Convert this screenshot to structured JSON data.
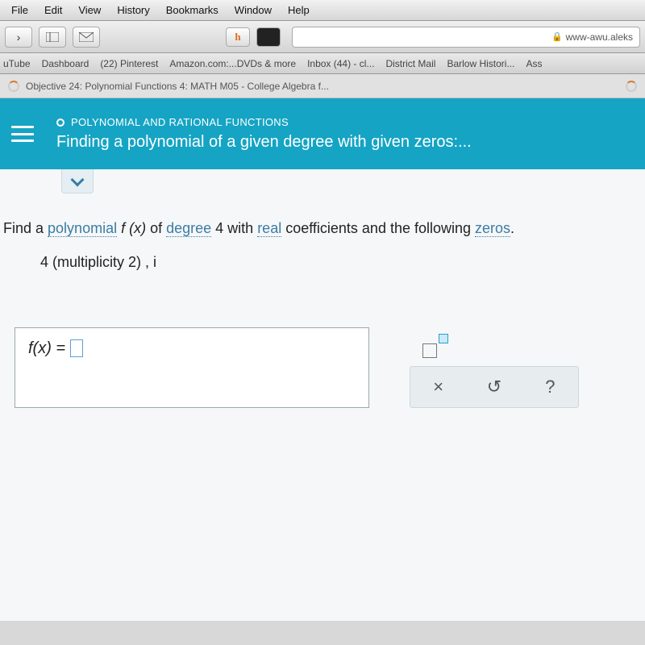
{
  "menubar": [
    "File",
    "Edit",
    "View",
    "History",
    "Bookmarks",
    "Window",
    "Help"
  ],
  "toolbar": {
    "url": "www-awu.aleks"
  },
  "bookmarks": [
    "uTube",
    "Dashboard",
    "(22) Pinterest",
    "Amazon.com:...DVDs & more",
    "Inbox (44) - cl...",
    "District Mail",
    "Barlow Histori...",
    "Ass"
  ],
  "tab": {
    "title": "Objective 24: Polynomial Functions 4: MATH M05 - College Algebra f..."
  },
  "banner": {
    "breadcrumb": "POLYNOMIAL AND RATIONAL FUNCTIONS",
    "title": "Finding a polynomial of a given degree with given zeros:..."
  },
  "question": {
    "pre": "Find a ",
    "link1": "polynomial",
    "fx": " f (x)",
    "mid1": " of ",
    "link2": "degree",
    "mid2": " 4 with ",
    "link3": "real",
    "mid3": " coefficients and the following ",
    "link4": "zeros",
    "post": "."
  },
  "given": {
    "text": "4 (multiplicity 2) ,  i"
  },
  "answer": {
    "lhs": "f(x) = "
  },
  "tools": {
    "clear": "×",
    "reset": "↺",
    "help": "?"
  }
}
